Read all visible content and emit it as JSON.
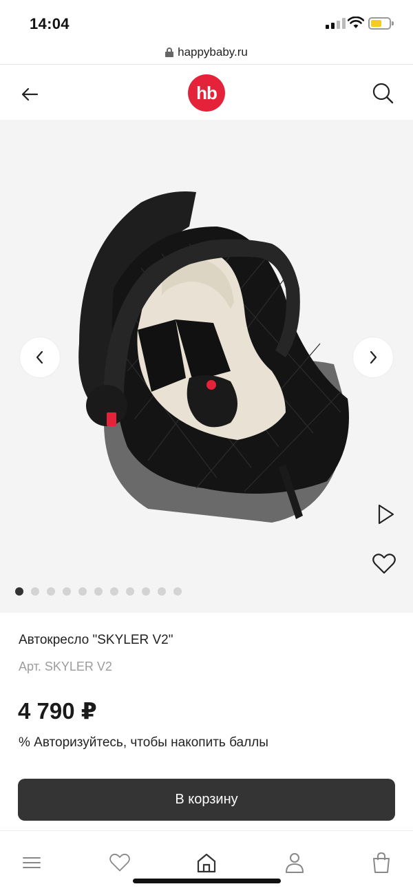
{
  "status_bar": {
    "time": "14:04"
  },
  "browser": {
    "url": "happybaby.ru"
  },
  "header": {
    "logo_text": "hb",
    "brand_color": "#e4233b",
    "icons": [
      "back-arrow-icon",
      "search-icon"
    ]
  },
  "gallery": {
    "image_alt": "Автокресло SKYLER V2",
    "slide_count": 11,
    "active_slide": 1,
    "icons": [
      "chevron-left-icon",
      "chevron-right-icon",
      "play-icon",
      "heart-icon"
    ]
  },
  "product": {
    "title": "Автокресло \"SKYLER V2\"",
    "sku": "Арт. SKYLER V2",
    "price": "4 790 ₽",
    "bonus_text": "% Авторизуйтесь, чтобы накопить баллы",
    "cart_button": "В корзину"
  },
  "tab_bar": {
    "items": [
      "menu-icon",
      "heart-icon",
      "home-icon",
      "user-icon",
      "bag-icon"
    ]
  },
  "colors": {
    "accent": "#e4233b",
    "button": "#343434",
    "gallery_bg": "#f4f4f4"
  }
}
